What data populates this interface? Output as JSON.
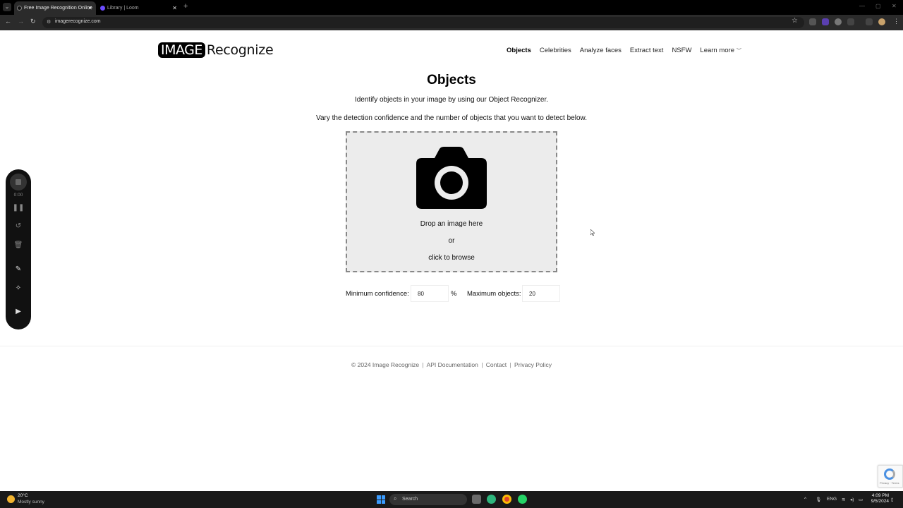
{
  "browser": {
    "tabs": [
      {
        "title": "Free Image Recognition Online",
        "active": true
      },
      {
        "title": "Library | Loom",
        "active": false
      }
    ],
    "url": "imagerecognize.com"
  },
  "site": {
    "logo_box": "IMAGE",
    "logo_text": "Recognize",
    "nav": [
      "Objects",
      "Celebrities",
      "Analyze faces",
      "Extract text",
      "NSFW",
      "Learn more"
    ],
    "active_nav": "Objects"
  },
  "main": {
    "title": "Objects",
    "description": "Identify objects in your image by using our Object Recognizer.",
    "instructions": "Vary the detection confidence and the number of objects that you want to detect below.",
    "dropzone": {
      "line1": "Drop an image here",
      "line2": "or",
      "line3": "click to browse"
    },
    "min_confidence_label": "Minimum confidence:",
    "min_confidence_value": "80",
    "percent_sign": "%",
    "max_objects_label": "Maximum objects:",
    "max_objects_value": "20"
  },
  "footer": {
    "copyright": "© 2024 Image Recognize",
    "links": [
      "API Documentation",
      "Contact",
      "Privacy Policy"
    ]
  },
  "recorder": {
    "time": "0:00"
  },
  "taskbar": {
    "weather_temp": "20°C",
    "weather_desc": "Mostly sunny",
    "search_label": "Search",
    "lang": "ENG",
    "time": "4:09 PM",
    "date": "9/5/2024"
  },
  "colors": {
    "accent": "#000000",
    "dropzone_bg": "#ececec",
    "dropzone_border": "#888888"
  }
}
